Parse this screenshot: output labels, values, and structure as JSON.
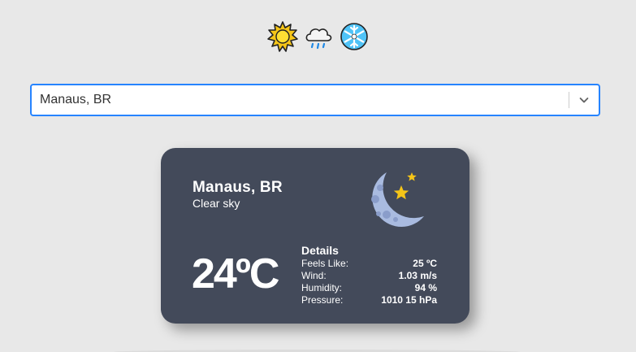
{
  "logos": [
    {
      "icon": "sun-icon",
      "color": "#f5c518"
    },
    {
      "icon": "rain-cloud-icon",
      "color": "#4fc3f7"
    },
    {
      "icon": "snowflake-icon",
      "color": "#4fc3f7"
    }
  ],
  "search": {
    "selected_value": "Manaus, BR",
    "indicator_icon": "chevron-down-icon",
    "focus_color": "#2684ff"
  },
  "weather_card": {
    "city": "Manaus, BR",
    "description": "Clear sky",
    "icon": "moon-stars-icon",
    "temperature": "24ºC",
    "details_title": "Details",
    "details": [
      {
        "label": "Feels Like:",
        "value": "25 ºC"
      },
      {
        "label": "Wind:",
        "value": "1.03 m/s"
      },
      {
        "label": "Humidity:",
        "value": "94 %"
      },
      {
        "label": "Pressure:",
        "value": "1010 15 hPa"
      }
    ],
    "background": "#434a5a"
  }
}
